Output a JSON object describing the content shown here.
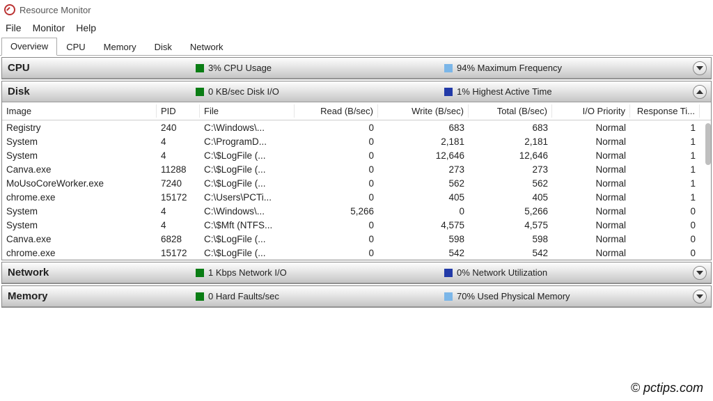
{
  "window": {
    "title": "Resource Monitor"
  },
  "menu": {
    "file": "File",
    "monitor": "Monitor",
    "help": "Help"
  },
  "tabs": {
    "overview": "Overview",
    "cpu": "CPU",
    "memory": "Memory",
    "disk": "Disk",
    "network": "Network"
  },
  "sections": {
    "cpu": {
      "name": "CPU",
      "metric1": "3% CPU Usage",
      "swatch1": "#0a7d14",
      "metric2": "94% Maximum Frequency",
      "swatch2": "#7bb6e8"
    },
    "disk": {
      "name": "Disk",
      "metric1": "0 KB/sec Disk I/O",
      "swatch1": "#0a7d14",
      "metric2": "1% Highest Active Time",
      "swatch2": "#223aa8"
    },
    "network": {
      "name": "Network",
      "metric1": "1 Kbps Network I/O",
      "swatch1": "#0a7d14",
      "metric2": "0% Network Utilization",
      "swatch2": "#223aa8"
    },
    "memory": {
      "name": "Memory",
      "metric1": "0 Hard Faults/sec",
      "swatch1": "#0a7d14",
      "metric2": "70% Used Physical Memory",
      "swatch2": "#7bb6e8"
    }
  },
  "disk_table": {
    "headers": {
      "image": "Image",
      "pid": "PID",
      "file": "File",
      "read": "Read (B/sec)",
      "write": "Write (B/sec)",
      "total": "Total (B/sec)",
      "priority": "I/O Priority",
      "response": "Response Ti..."
    },
    "rows": [
      {
        "image": "Registry",
        "pid": "240",
        "file": "C:\\Windows\\...",
        "read": "0",
        "write": "683",
        "total": "683",
        "priority": "Normal",
        "response": "1"
      },
      {
        "image": "System",
        "pid": "4",
        "file": "C:\\ProgramD...",
        "read": "0",
        "write": "2,181",
        "total": "2,181",
        "priority": "Normal",
        "response": "1"
      },
      {
        "image": "System",
        "pid": "4",
        "file": "C:\\$LogFile (...",
        "read": "0",
        "write": "12,646",
        "total": "12,646",
        "priority": "Normal",
        "response": "1"
      },
      {
        "image": "Canva.exe",
        "pid": "11288",
        "file": "C:\\$LogFile (...",
        "read": "0",
        "write": "273",
        "total": "273",
        "priority": "Normal",
        "response": "1"
      },
      {
        "image": "MoUsoCoreWorker.exe",
        "pid": "7240",
        "file": "C:\\$LogFile (...",
        "read": "0",
        "write": "562",
        "total": "562",
        "priority": "Normal",
        "response": "1"
      },
      {
        "image": "chrome.exe",
        "pid": "15172",
        "file": "C:\\Users\\PCTi...",
        "read": "0",
        "write": "405",
        "total": "405",
        "priority": "Normal",
        "response": "1"
      },
      {
        "image": "System",
        "pid": "4",
        "file": "C:\\Windows\\...",
        "read": "5,266",
        "write": "0",
        "total": "5,266",
        "priority": "Normal",
        "response": "0"
      },
      {
        "image": "System",
        "pid": "4",
        "file": "C:\\$Mft (NTFS...",
        "read": "0",
        "write": "4,575",
        "total": "4,575",
        "priority": "Normal",
        "response": "0"
      },
      {
        "image": "Canva.exe",
        "pid": "6828",
        "file": "C:\\$LogFile (...",
        "read": "0",
        "write": "598",
        "total": "598",
        "priority": "Normal",
        "response": "0"
      },
      {
        "image": "chrome.exe",
        "pid": "15172",
        "file": "C:\\$LogFile (...",
        "read": "0",
        "write": "542",
        "total": "542",
        "priority": "Normal",
        "response": "0"
      }
    ]
  },
  "watermark": "© pctips.com"
}
